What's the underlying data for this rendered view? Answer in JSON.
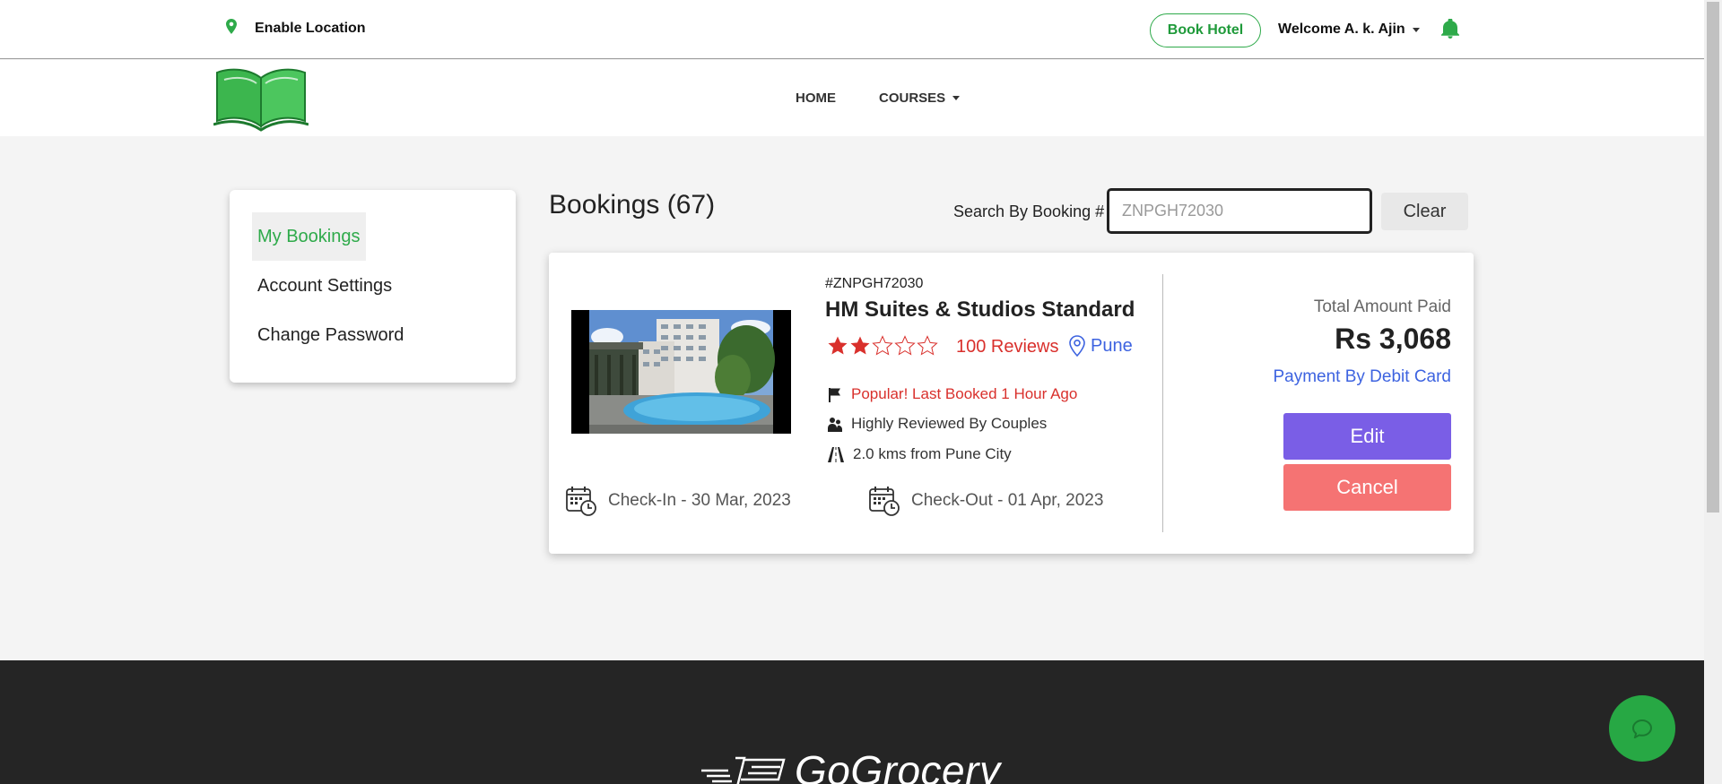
{
  "topbar": {
    "location_label": "Enable Location",
    "book_hotel_label": "Book Hotel",
    "welcome_label": "Welcome A. k. Ajin"
  },
  "nav": {
    "home_label": "HOME",
    "courses_label": "COURSES"
  },
  "sidebar": {
    "items": [
      {
        "label": "My Bookings",
        "active": true
      },
      {
        "label": "Account Settings",
        "active": false
      },
      {
        "label": "Change Password",
        "active": false
      }
    ]
  },
  "main": {
    "title": "Bookings (67)",
    "search": {
      "label": "Search By Booking #",
      "value": "ZNPGH72030",
      "clear_label": "Clear"
    }
  },
  "booking": {
    "number": "#ZNPGH72030",
    "hotel_name": "HM Suites & Studios Standard",
    "rating": 2,
    "rating_max": 5,
    "reviews": "100 Reviews",
    "city": "Pune",
    "features": {
      "popular": "Popular! Last Booked 1 Hour Ago",
      "couples": "Highly Reviewed By Couples",
      "distance": "2.0 kms from Pune City"
    },
    "checkin": "Check-In - 30 Mar, 2023",
    "checkout": "Check-Out - 01 Apr, 2023",
    "total_label": "Total Amount Paid",
    "amount": "Rs 3,068",
    "payment": "Payment By Debit Card",
    "edit_label": "Edit",
    "cancel_label": "Cancel"
  },
  "footer": {
    "brand": "GoGrocery"
  },
  "colors": {
    "brand_green": "#2eaa4a",
    "star_red": "#d9302c",
    "link_blue": "#3d63e0",
    "edit_purple": "#7a5ee6",
    "cancel_red": "#f57373",
    "footer_bg": "#252525"
  }
}
